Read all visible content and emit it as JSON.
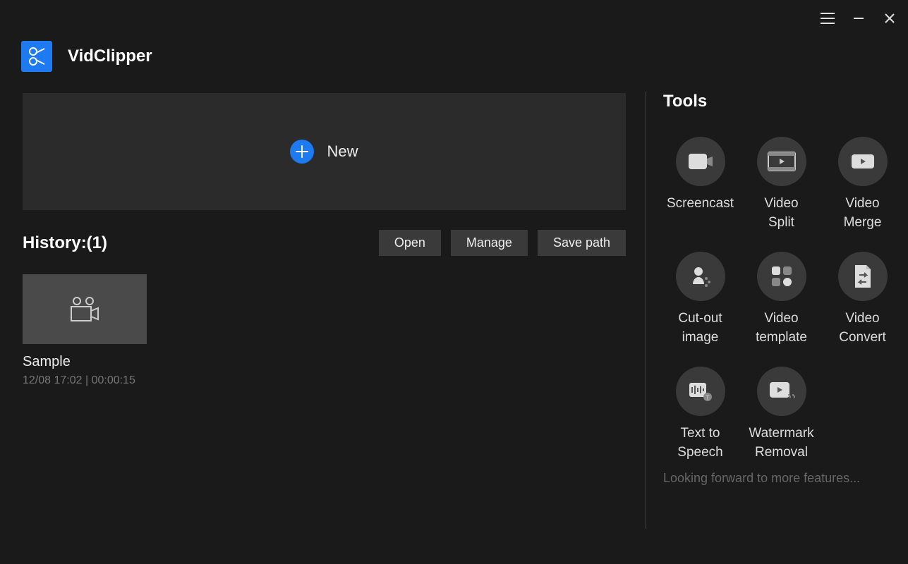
{
  "app": {
    "name": "VidClipper"
  },
  "newPanel": {
    "label": "New"
  },
  "history": {
    "title": "History:(1)",
    "actions": {
      "open": "Open",
      "manage": "Manage",
      "savePath": "Save path"
    },
    "items": [
      {
        "name": "Sample",
        "meta": "12/08 17:02 | 00:00:15"
      }
    ]
  },
  "tools": {
    "title": "Tools",
    "items": [
      {
        "label": "Screencast"
      },
      {
        "label": "Video\nSplit"
      },
      {
        "label": "Video\nMerge"
      },
      {
        "label": "Cut-out\nimage"
      },
      {
        "label": "Video\ntemplate"
      },
      {
        "label": "Video\nConvert"
      },
      {
        "label": "Text to\nSpeech"
      },
      {
        "label": "Watermark\nRemoval"
      }
    ],
    "footer": "Looking forward to more features..."
  }
}
